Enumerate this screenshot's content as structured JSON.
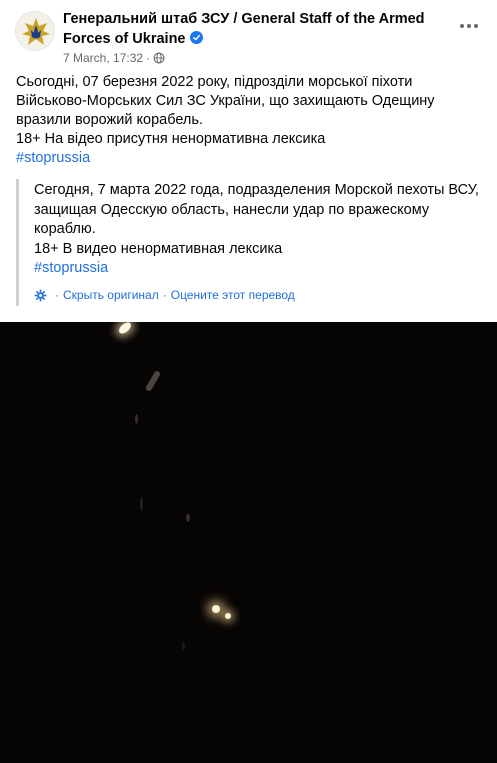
{
  "post": {
    "author": "Генеральний штаб ЗСУ / General Staff of the Armed Forces of Ukraine",
    "timestamp": "7 March, 17:32",
    "separator": "·",
    "audience_icon": "globe-icon",
    "verified_icon": "verified-badge-icon",
    "more_icon": "more-options-icon",
    "text_lines": [
      "Сьогодні, 07 березня 2022 року, підрозділи морської піхоти Військово-Морських Сил ЗС України, що захищають Одещину вразили ворожий корабель.",
      "18+ На відео присутня ненормативна лексика"
    ],
    "hashtag": "#stoprussia"
  },
  "translation": {
    "text_lines": [
      "Сегодня, 7 марта 2022 года, подразделения Морской пехоты ВСУ, защищая Одесскую область, нанесли удар по вражескому кораблю.",
      "18+ В видео ненормативная лексика"
    ],
    "hashtag": "#stoprussia",
    "hide_original": "Скрыть оригинал",
    "rate": "Оцените этот перевод",
    "dot": "·",
    "settings_icon": "gear-icon"
  },
  "colors": {
    "text": "#050505",
    "secondary": "#65676b",
    "link": "#216fdb",
    "verified": "#1877f2",
    "video_bg": "#070404"
  }
}
